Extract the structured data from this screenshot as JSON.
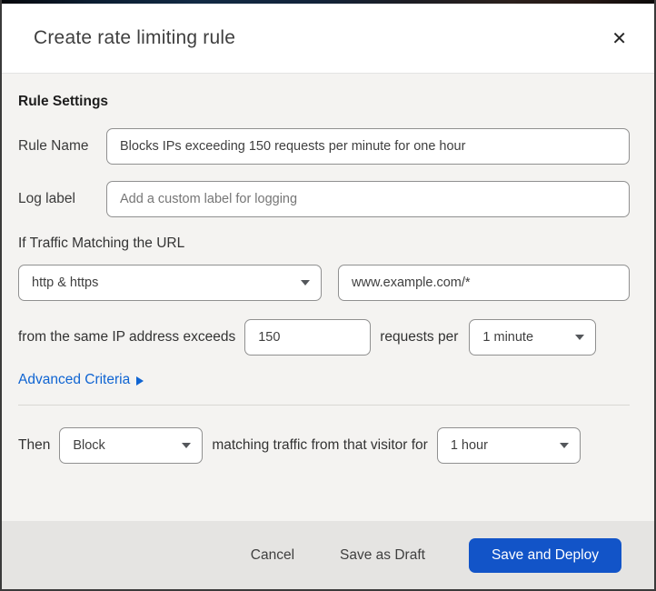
{
  "dialog": {
    "title": "Create rate limiting rule"
  },
  "icons": {
    "close": "✕"
  },
  "colors": {
    "link_blue": "#0f64d2",
    "primary_button_blue": "#1254c8",
    "body_background": "#f4f3f1",
    "footer_background": "#e5e4e2",
    "input_border": "#909090"
  },
  "rule_settings": {
    "heading": "Rule Settings",
    "rule_name": {
      "label": "Rule Name",
      "value": "Blocks IPs exceeding 150 requests per minute for one hour"
    },
    "log_label": {
      "label": "Log label",
      "placeholder": "Add a custom label for logging"
    }
  },
  "traffic_match": {
    "intro": "If Traffic Matching the URL",
    "scheme_selected": "http & https",
    "url_value": "www.example.com/*"
  },
  "threshold": {
    "prefix": "from the same IP address exceeds",
    "requests_value": "150",
    "middle": "requests per",
    "period_selected": "1 minute"
  },
  "advanced": {
    "link_label": "Advanced Criteria"
  },
  "action": {
    "prefix": "Then",
    "action_selected": "Block",
    "middle": "matching traffic from that visitor for",
    "duration_selected": "1 hour"
  },
  "footer": {
    "cancel_label": "Cancel",
    "save_draft_label": "Save as Draft",
    "save_deploy_label": "Save and Deploy"
  }
}
